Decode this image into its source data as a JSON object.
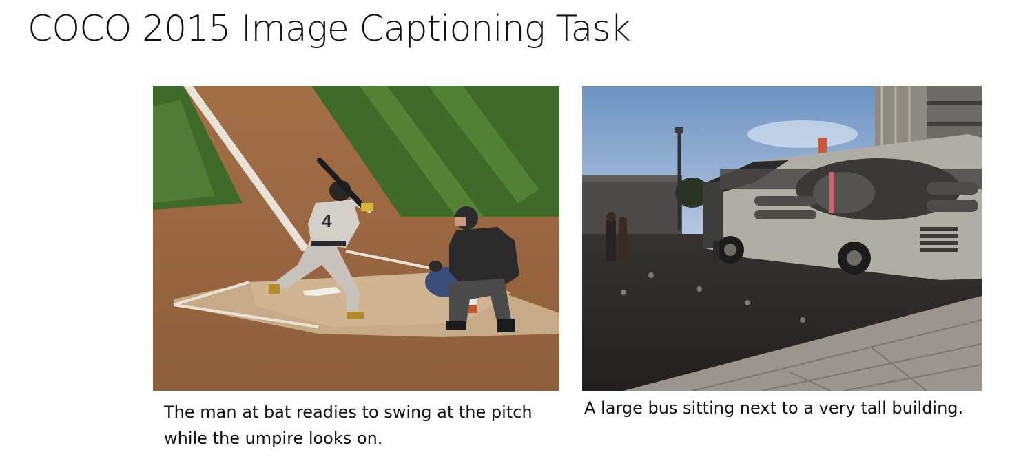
{
  "slide": {
    "title": "COCO 2015 Image Captioning Task"
  },
  "examples": [
    {
      "caption": "The man at bat readies to swing at the pitch while the umpire looks on.",
      "jersey_number": "4"
    },
    {
      "caption": "A large bus sitting next to a very tall building."
    }
  ],
  "colors": {
    "grass_dark": "#3f6b2a",
    "grass_light": "#5c8b3c",
    "dirt": "#9a6a44",
    "dirt_light": "#c9ad8a",
    "sky": "#a9c4e0",
    "pavement": "#2f2c28",
    "bus_body": "#a9a69e"
  }
}
